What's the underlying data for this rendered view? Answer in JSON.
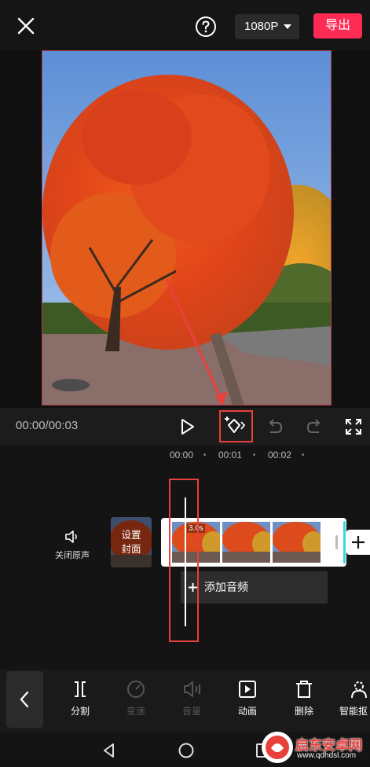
{
  "topbar": {
    "close_icon": "close-icon",
    "help_icon": "help-icon",
    "resolution": "1080P",
    "export_label": "导出",
    "export_color": "#fe2c55"
  },
  "player": {
    "time": "00:00/00:03",
    "icons": [
      "play-icon",
      "keyframe-icon",
      "undo-icon",
      "redo-icon",
      "fullscreen-icon"
    ]
  },
  "timeline": {
    "ruler": [
      "00:00",
      "00:01",
      "00:02"
    ],
    "mute_label": "关闭原声",
    "cover_label_line1": "设置",
    "cover_label_line2": "封面",
    "clip_duration": "3.0s",
    "add_audio_label": "添加音频"
  },
  "toolbar": {
    "items": [
      {
        "label": "分割",
        "icon": "split-icon",
        "enabled": true
      },
      {
        "label": "变速",
        "icon": "speed-icon",
        "enabled": false
      },
      {
        "label": "音量",
        "icon": "volume-icon",
        "enabled": false
      },
      {
        "label": "动画",
        "icon": "animation-icon",
        "enabled": true
      },
      {
        "label": "删除",
        "icon": "delete-icon",
        "enabled": true
      },
      {
        "label": "智能抠",
        "icon": "smart-cutout-icon",
        "enabled": true
      }
    ]
  },
  "watermark": {
    "text": "启东安卓网",
    "url": "www.qdhdsl.com"
  },
  "accent_color": "#e8413c"
}
